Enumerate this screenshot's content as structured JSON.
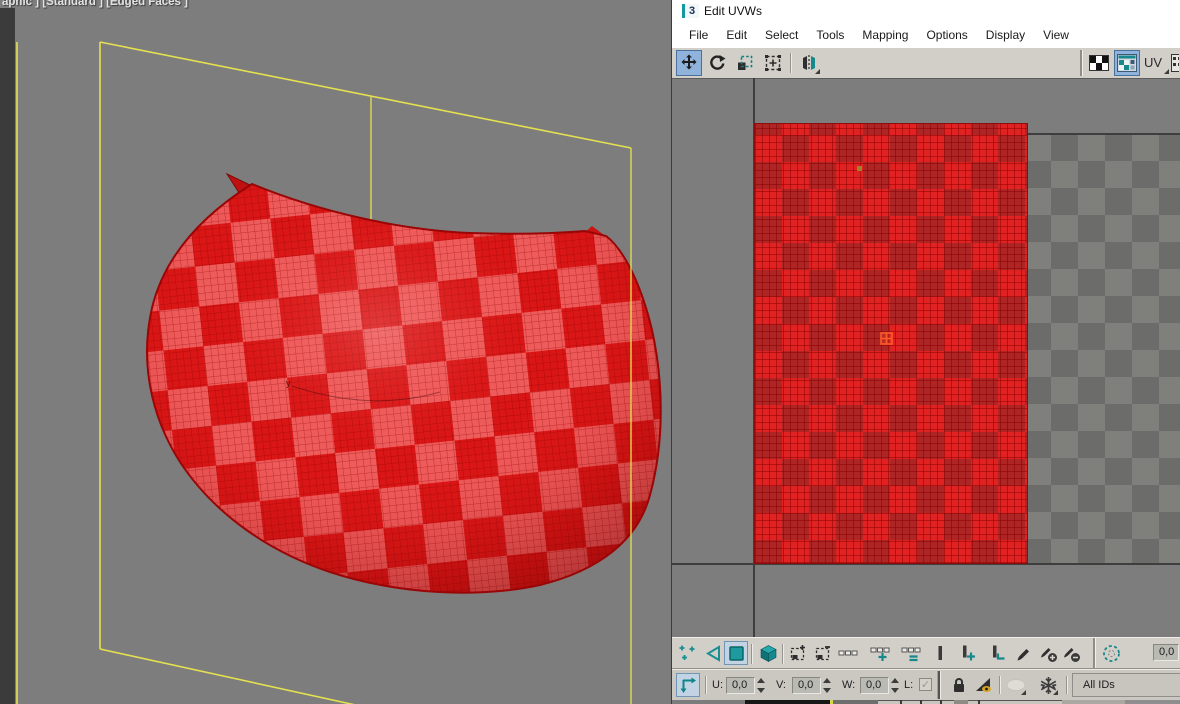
{
  "viewport": {
    "label": "aphic ] [Standard ] [Edged Faces ]",
    "axis_hint": "y",
    "colors": {
      "background": "#7d7d7d",
      "gizmo_yellow": "#e4e151",
      "mesh_red_light": "#ee5c5c",
      "mesh_red_dark": "#d91515"
    }
  },
  "window": {
    "title": "Edit UVWs",
    "title_icon": "3",
    "menus": [
      "File",
      "Edit",
      "Select",
      "Tools",
      "Mapping",
      "Options",
      "Display",
      "View"
    ],
    "toolbar": {
      "tools": [
        "move",
        "rotate",
        "scale",
        "freeform",
        "mirror"
      ],
      "active_tool": "move",
      "right": {
        "uv_space_label": "UV",
        "icons": [
          "checker-pattern",
          "show-map-in-viewport"
        ]
      }
    },
    "canvas": {
      "colors": {
        "background": "#7d7d7d",
        "checker_light": "#7f7f7c",
        "checker_dark": "#6c6c6a",
        "island_red": "#da1717",
        "marker_orange": "#ff5a2a"
      }
    },
    "subobject_toolbar": {
      "modes": [
        "vertex",
        "edge",
        "polygon",
        "element"
      ],
      "active_mode": "polygon",
      "icons": [
        "grow-selection",
        "shrink-selection",
        "select-loop",
        "grow-loop",
        "shrink-loop",
        "select-ring",
        "grow-ring",
        "shrink-ring",
        "paint-select",
        "paint-select-add",
        "paint-select-subtract",
        "soft-selection"
      ],
      "falloff_value": "0,0"
    },
    "statusbar": {
      "u_label": "U:",
      "u_value": "0,0",
      "v_label": "V:",
      "v_value": "0,0",
      "w_label": "W:",
      "w_value": "0,0",
      "lock_label": "L:",
      "material_id_filter": "All IDs",
      "icons": [
        "absolute-typein",
        "lock-selection",
        "filter-selected-faces",
        "hide-selected",
        "freeze-selected"
      ]
    },
    "colors": {
      "titlebar_bg": "#ffffff",
      "toolbar_bg": "#d2cfc9",
      "accent_teal": "#17888b",
      "active_button_bg": "#8fb3da"
    }
  }
}
